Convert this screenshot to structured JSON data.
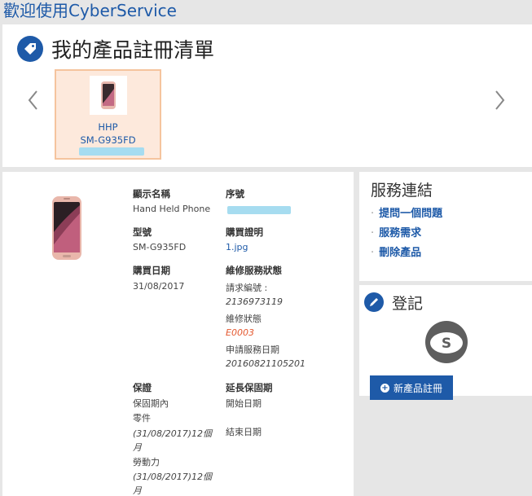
{
  "welcome": "歡迎使用CyberService",
  "products": {
    "title": "我的產品註冊清單",
    "card": {
      "type": "HHP",
      "model": "SM-G935FD"
    }
  },
  "detail": {
    "display_name_label": "顯示名稱",
    "display_name": "Hand Held Phone",
    "serial_label": "序號",
    "model_label": "型號",
    "model": "SM-G935FD",
    "proof_label": "購買證明",
    "proof_file": "1.jpg",
    "purchase_date_label": "購買日期",
    "purchase_date": "31/08/2017",
    "repair_status_label": "維修服務狀態",
    "request_no_label": "請求編號 :",
    "request_no": "2136973119",
    "repair_state_label": "維修狀態",
    "repair_state": "E0003",
    "apply_date_label": "申請服務日期",
    "apply_date": "20160821105201",
    "warranty_label": "保證",
    "in_warranty": "保固期內",
    "parts_label": "零件",
    "parts_value_1": "(31/08/2017)12個",
    "parts_value_2": "月",
    "labor_label": "勞動力",
    "labor_value_1": "(31/08/2017)12個",
    "labor_value_2": "月",
    "ext_warranty_label": "延長保固期",
    "start_date_label": "開始日期",
    "end_date_label": "結束日期"
  },
  "service": {
    "title": "服務連結",
    "links": [
      "提問一個問題",
      "服務需求",
      "刪除產品"
    ]
  },
  "register": {
    "title": "登記",
    "logo_letter": "S",
    "button": "新產品註冊"
  },
  "colors": {
    "brand": "#1e5aa8",
    "error": "#e4572e",
    "card_bg": "#fde9dc"
  }
}
